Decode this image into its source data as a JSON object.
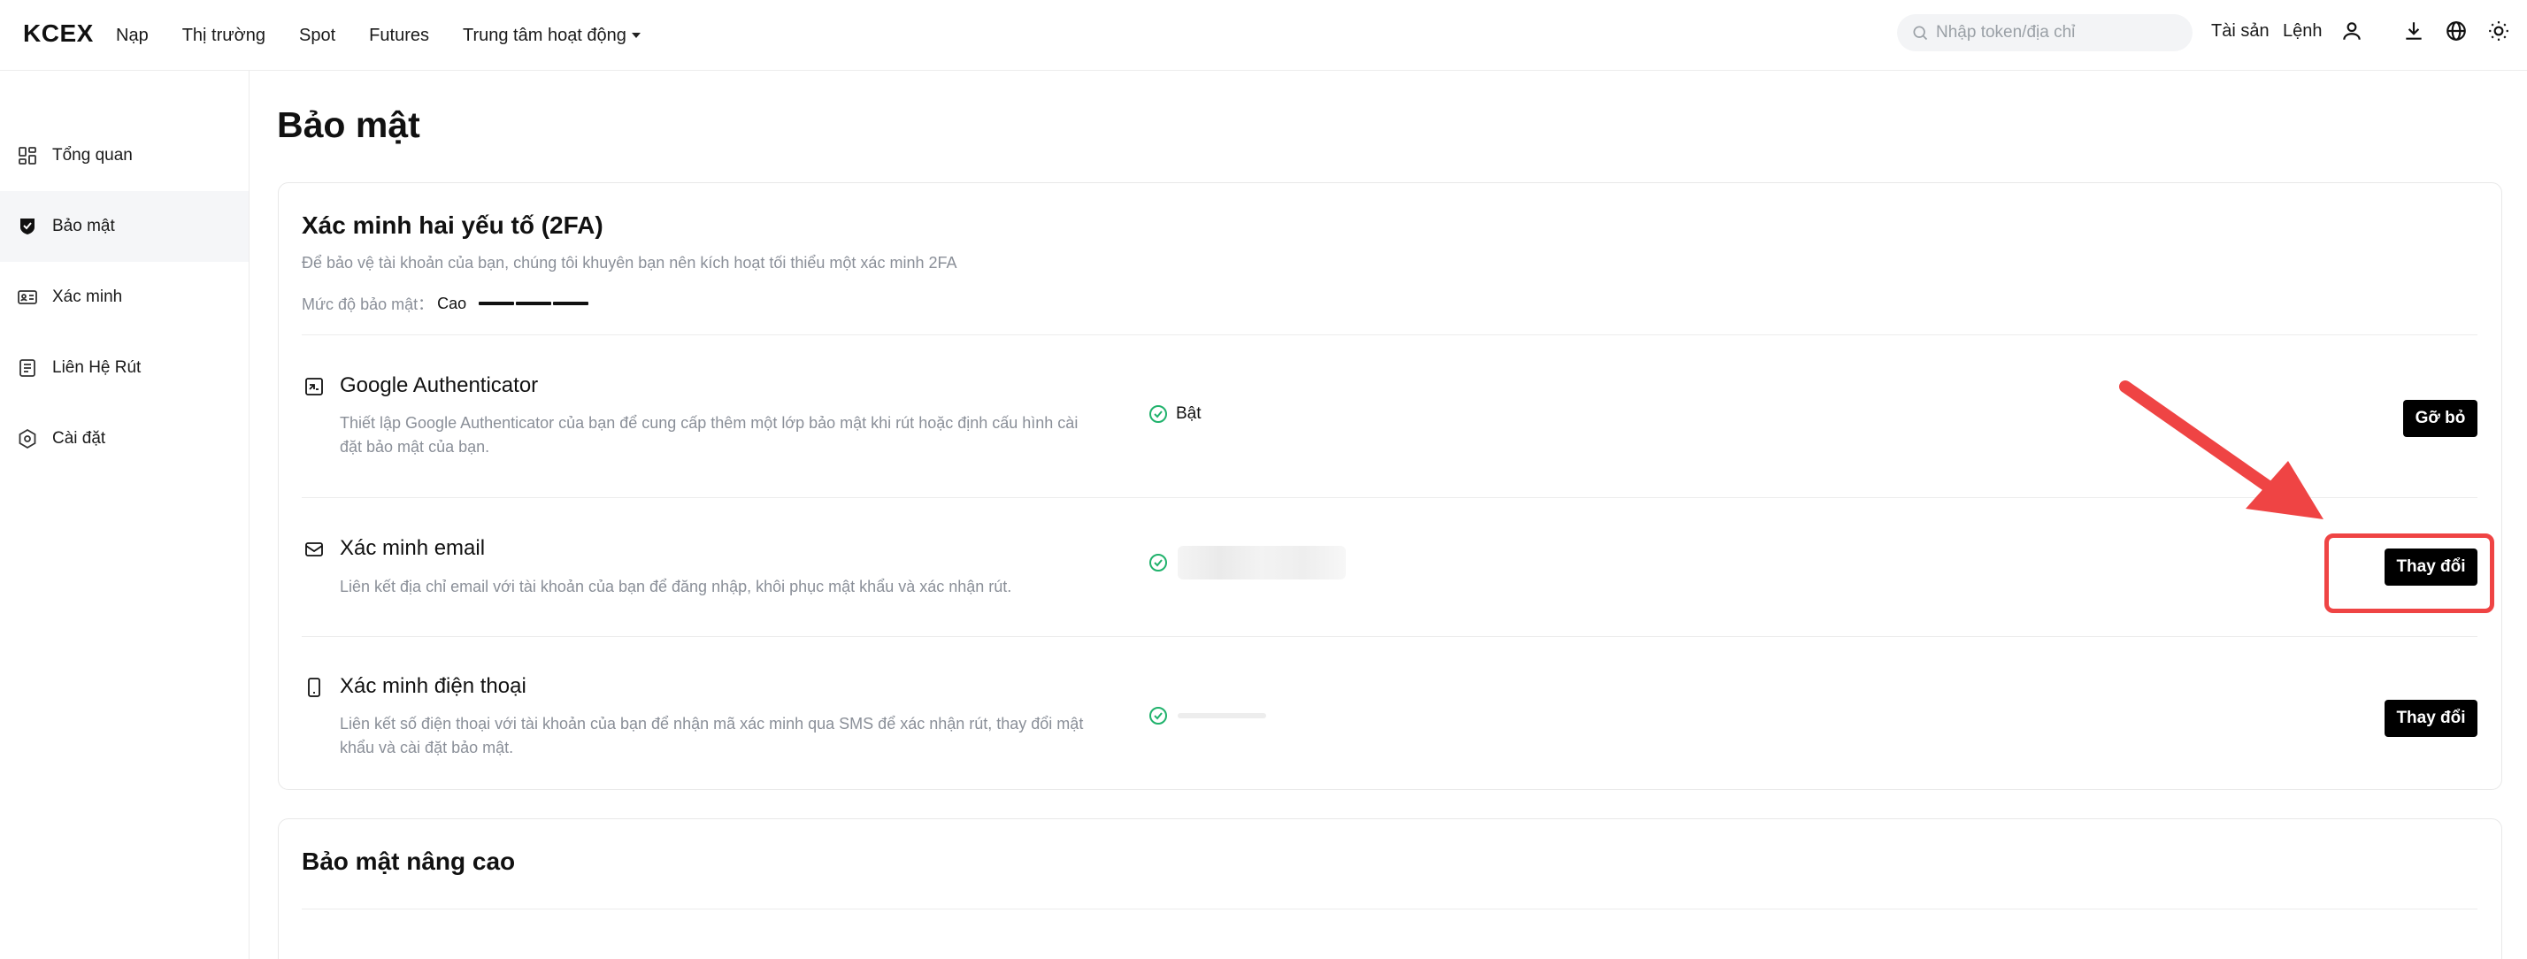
{
  "header": {
    "logo": "KCEX",
    "nav": [
      {
        "label": "Nạp"
      },
      {
        "label": "Thị trường"
      },
      {
        "label": "Spot"
      },
      {
        "label": "Futures"
      },
      {
        "label": "Trung tâm hoạt động",
        "has_dropdown": true
      }
    ],
    "search": {
      "placeholder": "Nhập token/địa chỉ",
      "value": ""
    },
    "assets_label": "Tài sản",
    "orders_label": "Lệnh",
    "icons": [
      "user-icon",
      "download-icon",
      "globe-icon",
      "sun-icon"
    ]
  },
  "sidebar": {
    "items": [
      {
        "label": "Tổng quan",
        "icon": "dashboard-icon",
        "active": false
      },
      {
        "label": "Bảo mật",
        "icon": "shield-check-icon",
        "active": true
      },
      {
        "label": "Xác minh",
        "icon": "id-card-icon",
        "active": false
      },
      {
        "label": "Liên Hệ Rút",
        "icon": "contacts-icon",
        "active": false
      },
      {
        "label": "Cài đặt",
        "icon": "settings-icon",
        "active": false
      }
    ]
  },
  "main": {
    "title": "Bảo mật",
    "twofa": {
      "title": "Xác minh hai yếu tố (2FA)",
      "subtitle": "Để bảo vệ tài khoản của bạn, chúng tôi khuyên bạn nên kích hoạt tối thiểu một xác minh 2FA",
      "level_label": "Mức độ bảo mật：",
      "level_value": "Cao",
      "level_segments": 3,
      "rows": [
        {
          "icon": "authenticator-icon",
          "title": "Google Authenticator",
          "desc": "Thiết lập Google Authenticator của bạn để cung cấp thêm một lớp bảo mật khi rút hoặc định cấu hình cài đặt bảo mật của bạn.",
          "status": "Bật",
          "button": "Gỡ bỏ"
        },
        {
          "icon": "email-icon",
          "title": "Xác minh email",
          "desc": "Liên kết địa chỉ email với tài khoản của bạn để đăng nhập, khôi phục mật khẩu và xác nhận rút.",
          "status": "",
          "button": "Thay đổi"
        },
        {
          "icon": "phone-icon",
          "title": "Xác minh điện thoại",
          "desc": "Liên kết số điện thoại với tài khoản của bạn để nhận mã xác minh qua SMS để xác nhận rút, thay đổi mật khẩu và cài đặt bảo mật.",
          "status": "",
          "button": "Thay đổi"
        }
      ]
    },
    "advanced": {
      "title": "Bảo mật nâng cao"
    }
  },
  "colors": {
    "accent": "#000000",
    "success": "#20b26c",
    "annotation": "#ef4444",
    "muted_text": "#8a8f98"
  }
}
